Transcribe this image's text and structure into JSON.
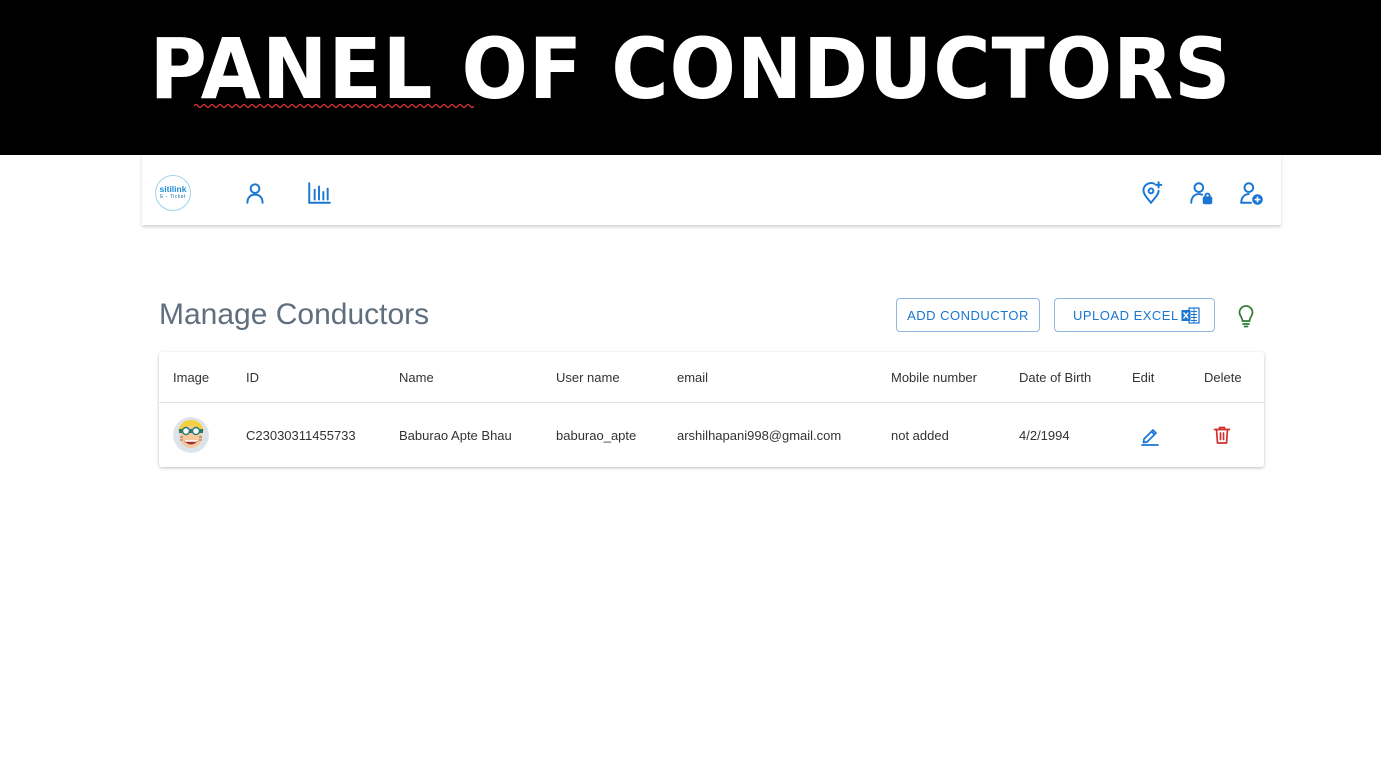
{
  "banner": {
    "title": "PANEL OF CONDUCTORS"
  },
  "navbar": {
    "logo": {
      "line1": "sitilink",
      "line2": "E - Ticket"
    },
    "left_icons": [
      "user-icon",
      "bar-chart-icon"
    ],
    "right_icons": [
      "location-add-icon",
      "user-lock-icon",
      "user-add-icon"
    ]
  },
  "page": {
    "title": "Manage Conductors",
    "add_button": "ADD CONDUCTOR",
    "upload_button": "UPLOAD EXCEL",
    "hint_icon": "lightbulb-icon"
  },
  "table": {
    "headers": {
      "image": "Image",
      "id": "ID",
      "name": "Name",
      "username": "User name",
      "email": "email",
      "mobile": "Mobile number",
      "dob": "Date of Birth",
      "edit": "Edit",
      "delete": "Delete"
    },
    "rows": [
      {
        "id": "C23030311455733",
        "name": "Baburao Apte Bhau",
        "username": "baburao_apte",
        "email": "arshilhapani998@gmail.com",
        "mobile": "not added",
        "dob": "4/2/1994"
      }
    ]
  },
  "colors": {
    "primary": "#1976d2",
    "delete": "#d32f2f",
    "hint": "#2e7d32",
    "title": "#5f6f80"
  }
}
